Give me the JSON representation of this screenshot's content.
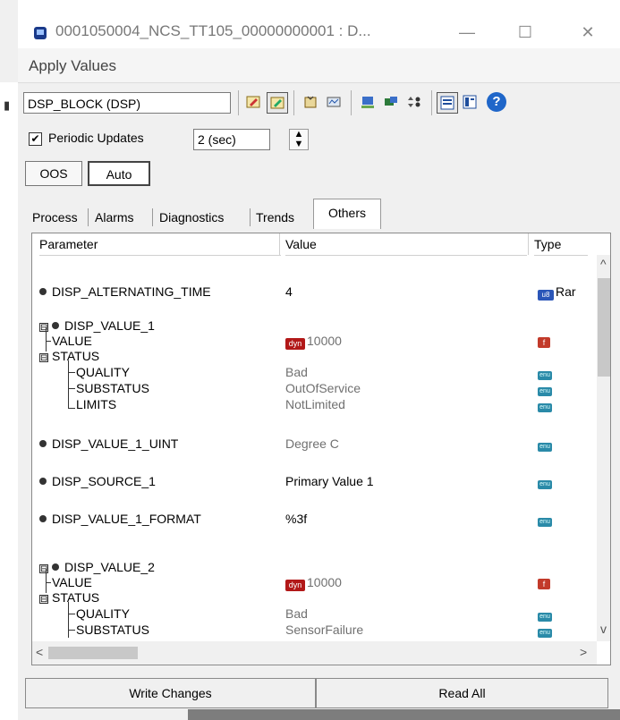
{
  "window": {
    "title": "0001050004_NCS_TT105_00000000001 : D...",
    "subtitle": "Apply Values",
    "minimize_glyph": "—",
    "maximize_glyph": "☐",
    "close_glyph": "✕"
  },
  "toolbar": {
    "block_select_value": "DSP_BLOCK (DSP)",
    "help_glyph": "?"
  },
  "periodic": {
    "checkbox_checked": true,
    "checkbox_glyph": "✔",
    "label": "Periodic Updates",
    "interval_value": "2 (sec)"
  },
  "modes": {
    "oos_label": "OOS",
    "auto_label": "Auto"
  },
  "tabs": [
    {
      "label": "Process"
    },
    {
      "label": "Alarms"
    },
    {
      "label": "Diagnostics"
    },
    {
      "label": "Trends"
    },
    {
      "label": "Others"
    }
  ],
  "active_tab": "Others",
  "grid": {
    "headers": {
      "parameter": "Parameter",
      "value": "Value",
      "type": "Type"
    },
    "rows": {
      "r1": {
        "param": "DISP_ALTERNATING_TIME",
        "value": "4",
        "type_icon": "u8",
        "type": "Rar"
      },
      "r2": {
        "param": "DISP_VALUE_1"
      },
      "r3": {
        "param": "VALUE",
        "value": "10000",
        "value_icon": "dyn",
        "type_icon": "f"
      },
      "r4": {
        "param": "STATUS"
      },
      "r5": {
        "param": "QUALITY",
        "value": "Bad",
        "type_icon": "enu"
      },
      "r6": {
        "param": "SUBSTATUS",
        "value": "OutOfService",
        "type_icon": "enu"
      },
      "r7": {
        "param": "LIMITS",
        "value": "NotLimited",
        "type_icon": "enu"
      },
      "r8": {
        "param": "DISP_VALUE_1_UINT",
        "value": "Degree C",
        "type_icon": "enu"
      },
      "r9": {
        "param": "DISP_SOURCE_1",
        "value": "Primary Value 1",
        "type_icon": "enu"
      },
      "r10": {
        "param": "DISP_VALUE_1_FORMAT",
        "value": "%3f",
        "type_icon": "enu"
      },
      "r11": {
        "param": "DISP_VALUE_2"
      },
      "r12": {
        "param": "VALUE",
        "value": "10000",
        "value_icon": "dyn",
        "type_icon": "f"
      },
      "r13": {
        "param": "STATUS"
      },
      "r14": {
        "param": "QUALITY",
        "value": "Bad",
        "type_icon": "enu"
      },
      "r15": {
        "param": "SUBSTATUS",
        "value": "SensorFailure",
        "type_icon": "enu"
      }
    },
    "expand_glyph": "⊟",
    "scroll_up": "^",
    "scroll_down": "v",
    "scroll_left": "<",
    "scroll_right": ">"
  },
  "buttons": {
    "write_changes": "Write Changes",
    "read_all": "Read All"
  },
  "colors": {
    "accent_blue": "#1f66c9",
    "dyn_red": "#b21818",
    "enum_teal": "#2a8aa8"
  }
}
